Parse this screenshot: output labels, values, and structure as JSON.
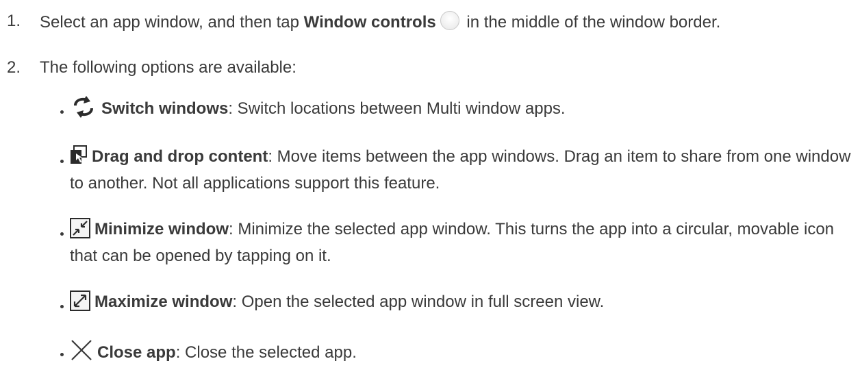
{
  "steps": [
    {
      "number": "1.",
      "pre": "Select an app window, and then tap ",
      "bold": "Window controls",
      "icon": "circle-window-controls-icon",
      "post": " in the middle of the window border."
    },
    {
      "number": "2.",
      "text": "The following options are available:"
    }
  ],
  "options": [
    {
      "icon": "switch-windows-icon",
      "title": "Switch windows",
      "desc": ": Switch locations between Multi window apps."
    },
    {
      "icon": "drag-drop-icon",
      "title": "Drag and drop content",
      "desc": ": Move items between the app windows. Drag an item to share from one window to another. Not all applications support this feature."
    },
    {
      "icon": "minimize-window-icon",
      "title": "Minimize window",
      "desc": ": Minimize the selected app window. This turns the app into a circular, movable icon that can be opened by tapping on it."
    },
    {
      "icon": "maximize-window-icon",
      "title": "Maximize window",
      "desc": ": Open the selected app window in full screen view."
    },
    {
      "icon": "close-icon",
      "title": "Close app",
      "desc": ": Close the selected app."
    }
  ]
}
